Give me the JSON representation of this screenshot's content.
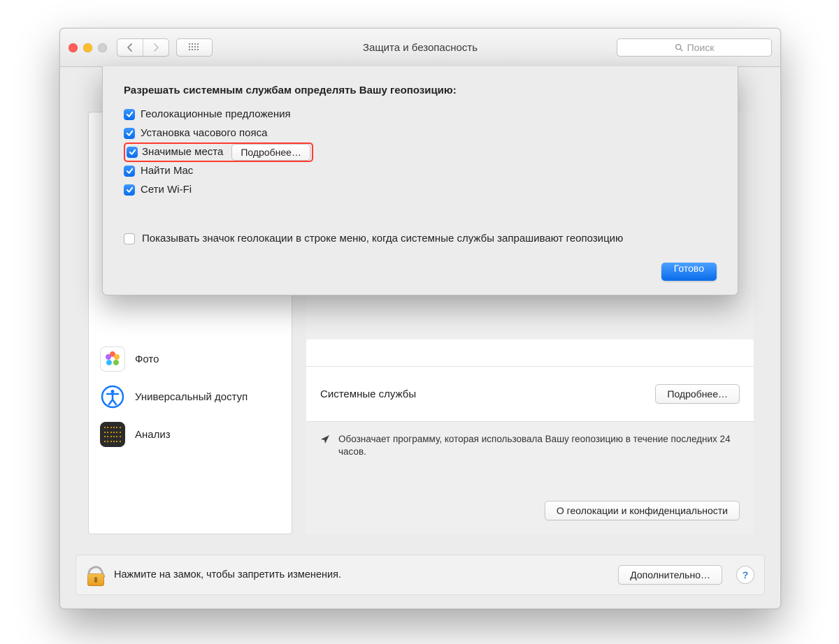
{
  "window": {
    "title": "Защита и безопасность",
    "search_placeholder": "Поиск"
  },
  "sheet": {
    "heading": "Разрешать системным службам определять Вашу геопозицию:",
    "services": [
      {
        "label": "Геолокационные предложения",
        "checked": true,
        "more": false,
        "highlight": false
      },
      {
        "label": "Установка часового пояса",
        "checked": true,
        "more": false,
        "highlight": false
      },
      {
        "label": "Значимые места",
        "checked": true,
        "more": true,
        "highlight": true
      },
      {
        "label": "Найти Mac",
        "checked": true,
        "more": false,
        "highlight": false
      },
      {
        "label": "Сети Wi-Fi",
        "checked": true,
        "more": false,
        "highlight": false
      }
    ],
    "more_label": "Подробнее…",
    "menubar_indicator": {
      "label": "Показывать значок геолокации в строке меню, когда системные службы запрашивают геопозицию",
      "checked": false
    },
    "done": "Готово"
  },
  "left_panel": {
    "items": [
      {
        "label": "Фото"
      },
      {
        "label": "Универсальный доступ"
      },
      {
        "label": "Анализ"
      }
    ]
  },
  "right_panel": {
    "system_services": "Системные службы",
    "system_services_more": "Подробнее…",
    "indicator_note": "Обозначает программу, которая использовала Вашу геопозицию в течение последних 24 часов.",
    "about_privacy": "О геолокации и конфиденциальности"
  },
  "footer": {
    "lock_text": "Нажмите на замок, чтобы запретить изменения.",
    "advanced": "Дополнительно…",
    "help": "?"
  }
}
